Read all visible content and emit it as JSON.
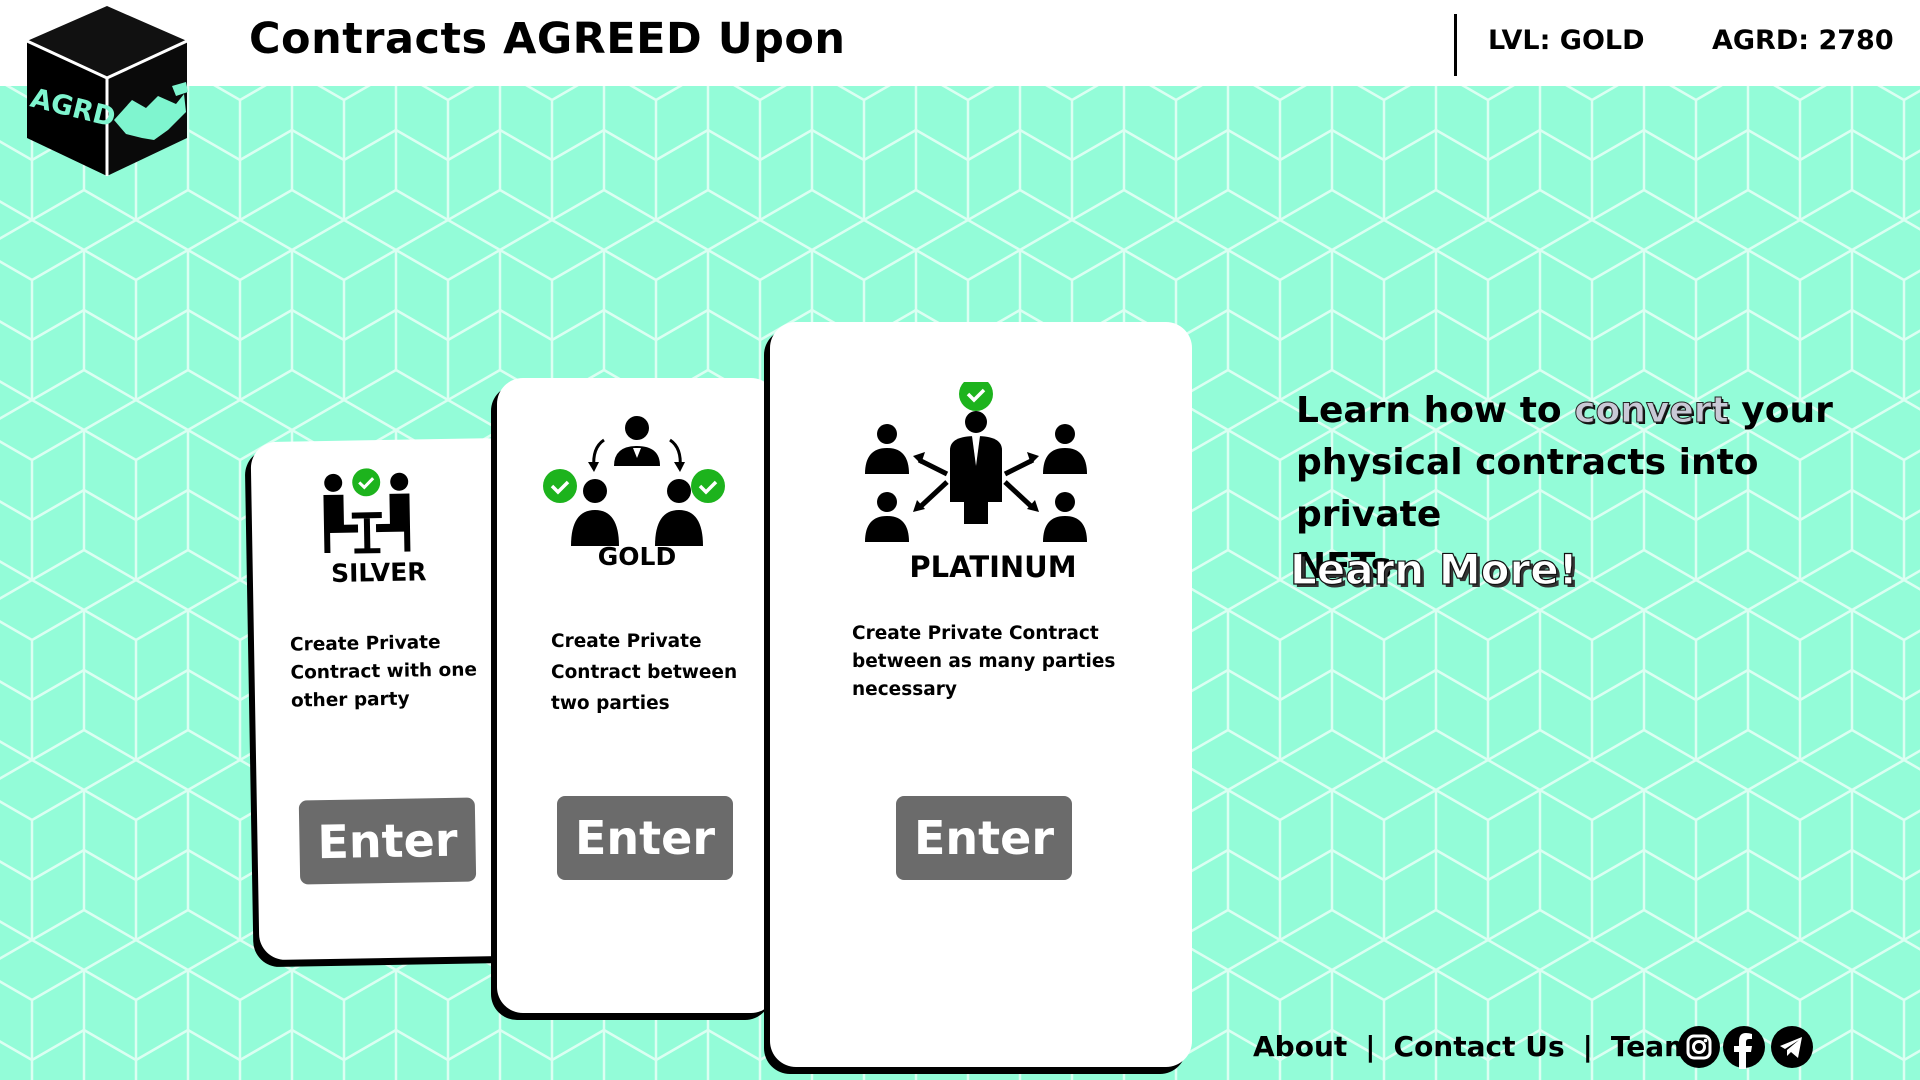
{
  "header": {
    "logo_text": "AGRD",
    "title": "Contracts AGREED Upon",
    "level": "LVL: GOLD",
    "balance": "AGRD: 2780"
  },
  "tiers": [
    {
      "name": "SILVER",
      "description_lines": [
        "Create Private",
        "Contract with one",
        "other party"
      ],
      "button_label": "Enter"
    },
    {
      "name": "GOLD",
      "description_lines": [
        "Create Private",
        "Contract between",
        "two parties"
      ],
      "button_label": "Enter"
    },
    {
      "name": "PLATINUM",
      "description_lines": [
        "Create Private Contract",
        "between as many parties",
        "necessary"
      ],
      "button_label": "Enter"
    }
  ],
  "promo": {
    "part1": "Learn how to ",
    "highlight": "convert",
    "part2": " your",
    "line2": "physical contracts into private",
    "line3": "NFTs",
    "link_label": "Learn More!"
  },
  "footer": {
    "links": [
      "About",
      "Contact Us",
      "Team"
    ],
    "separator": "|",
    "social_icons": [
      "instagram-icon",
      "facebook-icon",
      "telegram-icon"
    ]
  },
  "colors": {
    "background": "#93fcd8",
    "accent": "#7ff5cf",
    "check_green": "#1db31d",
    "button_gray": "#6b6b6b"
  }
}
